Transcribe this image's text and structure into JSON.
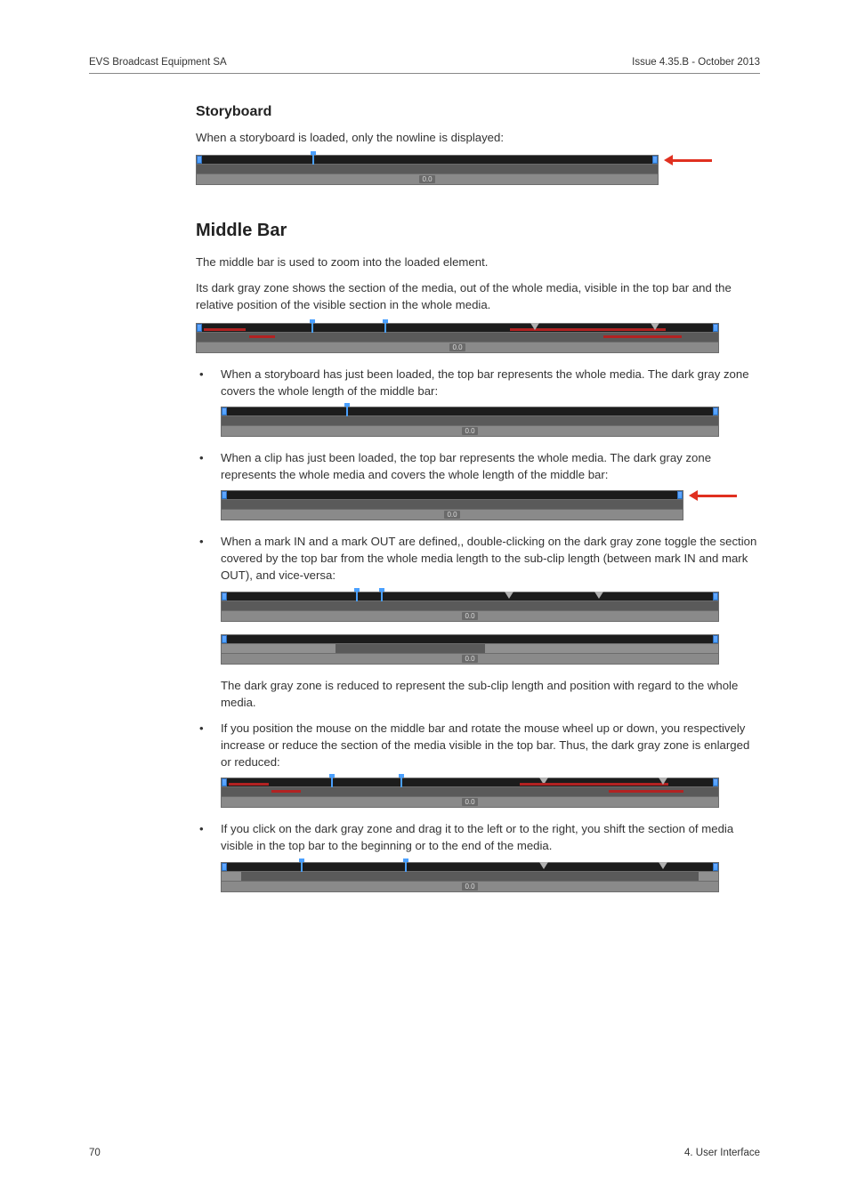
{
  "header": {
    "left": "EVS Broadcast Equipment SA",
    "right": "Issue 4.35.B - October 2013"
  },
  "sections": {
    "storyboard_h": "Storyboard",
    "storyboard_p": "When a storyboard is loaded, only the nowline is displayed:",
    "middlebar_h": "Middle Bar",
    "middlebar_p1": "The middle bar is used to zoom into the loaded element.",
    "middlebar_p2": "Its dark gray zone shows the section of the media, out of the whole media, visible in the top bar and the relative position of the visible section in the whole media.",
    "b1": "When a storyboard has just been loaded, the top bar represents the whole media. The dark gray zone covers the whole length of the middle bar:",
    "b2": "When a clip has just been loaded, the top bar represents the whole media. The dark gray zone represents the whole media and covers the whole length of the middle bar:",
    "b3": "When a mark IN and a mark OUT are defined,, double-clicking on the dark gray zone toggle the section covered by the top bar from the whole media length to the sub-clip length (between mark IN and mark OUT), and vice-versa:",
    "b3_after": "The dark gray zone is reduced to represent the sub-clip length and position with regard to the whole media.",
    "b4": "If you position the mouse on the middle bar and rotate the mouse wheel up or down, you respectively increase or reduce the section of the media visible in the top bar. Thus, the dark gray zone is enlarged or reduced:",
    "b5": "If you click on the dark gray zone and drag it to the left or to the right, you shift the section of media visible in the top bar to the beginning or to the end of the media."
  },
  "labels": {
    "zero": "0.0"
  },
  "footer": {
    "page": "70",
    "section": "4. User Interface"
  }
}
